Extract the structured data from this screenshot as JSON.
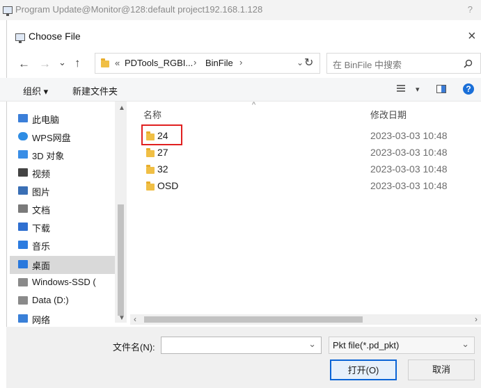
{
  "outer_window": {
    "title": "Program Update@Monitor@128:default project192.168.1.128",
    "help": "?"
  },
  "dialog": {
    "title": "Choose File",
    "close": "×"
  },
  "nav": {
    "back": "←",
    "forward": "→",
    "recent": "⌄",
    "up": "↑",
    "refresh": "↻"
  },
  "address": {
    "overflow": "«",
    "crumbs": [
      "PDTools_RGBI...",
      "BinFile"
    ],
    "sep": "›"
  },
  "search": {
    "placeholder": "在 BinFile 中搜索"
  },
  "toolbar": {
    "organize": "组织 ▾",
    "new_folder": "新建文件夹",
    "view_options": "▾"
  },
  "sidebar": {
    "items": [
      {
        "label": "此电脑",
        "icon": "computer-icon"
      },
      {
        "label": "WPS网盘",
        "icon": "cloud-icon"
      },
      {
        "label": "3D 对象",
        "icon": "cube-icon"
      },
      {
        "label": "视频",
        "icon": "video-icon"
      },
      {
        "label": "图片",
        "icon": "picture-icon"
      },
      {
        "label": "文档",
        "icon": "document-icon"
      },
      {
        "label": "下载",
        "icon": "download-icon"
      },
      {
        "label": "音乐",
        "icon": "music-icon"
      },
      {
        "label": "桌面",
        "icon": "desktop-icon",
        "selected": true
      },
      {
        "label": "Windows-SSD (",
        "icon": "drive-icon"
      },
      {
        "label": "Data (D:)",
        "icon": "drive-icon"
      },
      {
        "label": "网络",
        "icon": "network-icon"
      }
    ]
  },
  "list": {
    "columns": {
      "name": "名称",
      "date": "修改日期"
    },
    "rows": [
      {
        "name": "24",
        "date": "2023-03-03 10:48",
        "highlighted": true
      },
      {
        "name": "27",
        "date": "2023-03-03 10:48"
      },
      {
        "name": "32",
        "date": "2023-03-03 10:48"
      },
      {
        "name": "OSD",
        "date": "2023-03-03 10:48"
      }
    ]
  },
  "footer": {
    "filename_label": "文件名(N):",
    "filename_value": "",
    "filetype": "Pkt file(*.pd_pkt)",
    "open_button": "打开(O)",
    "cancel_button": "取消"
  },
  "colors": {
    "highlight_box": "#e02020",
    "selected_row": "#cce8ff",
    "selected_nav": "#d9d9d9",
    "accent": "#0a64d6"
  }
}
